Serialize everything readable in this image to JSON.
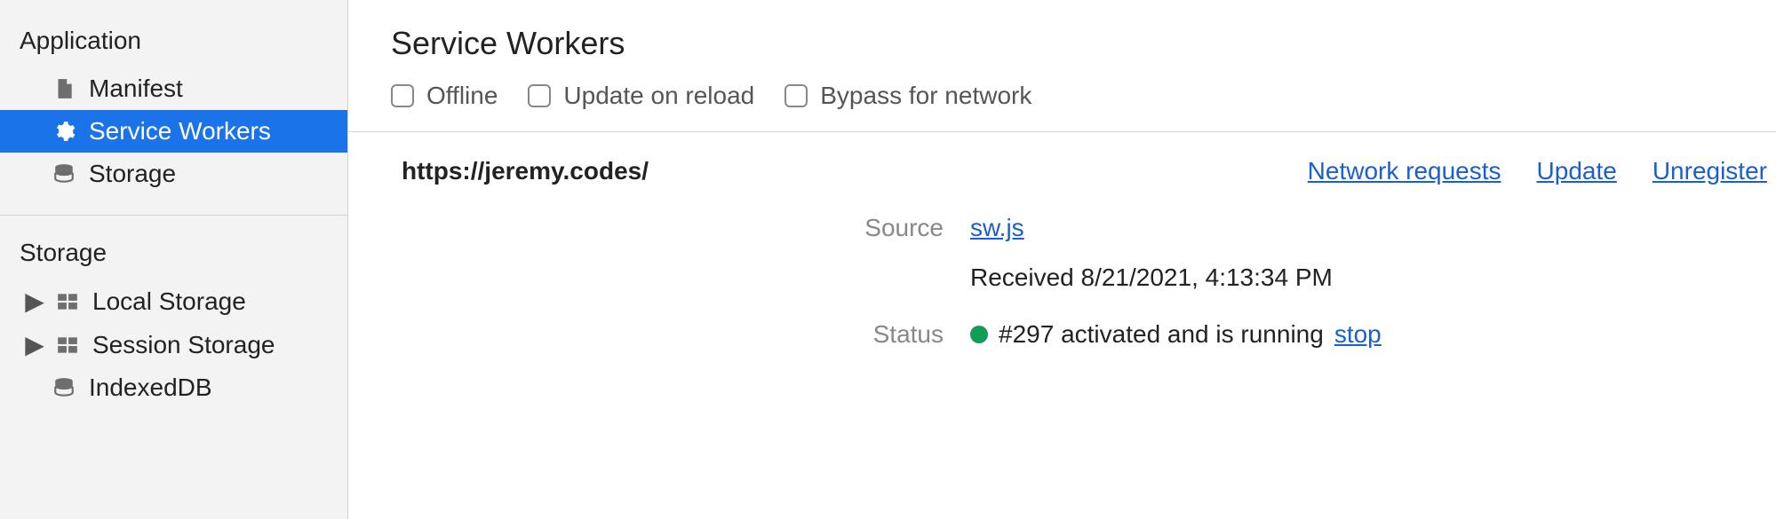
{
  "sidebar": {
    "sections": [
      {
        "title": "Application",
        "items": [
          {
            "label": "Manifest",
            "icon": "file",
            "selected": false,
            "expandable": false
          },
          {
            "label": "Service Workers",
            "icon": "gear",
            "selected": true,
            "expandable": false
          },
          {
            "label": "Storage",
            "icon": "db",
            "selected": false,
            "expandable": false
          }
        ]
      },
      {
        "title": "Storage",
        "items": [
          {
            "label": "Local Storage",
            "icon": "grid",
            "selected": false,
            "expandable": true
          },
          {
            "label": "Session Storage",
            "icon": "grid",
            "selected": false,
            "expandable": true
          },
          {
            "label": "IndexedDB",
            "icon": "db",
            "selected": false,
            "expandable": false
          }
        ]
      }
    ]
  },
  "main": {
    "heading": "Service Workers",
    "toolbar": {
      "offline": "Offline",
      "updateOnReload": "Update on reload",
      "bypass": "Bypass for network"
    },
    "origin": "https://jeremy.codes/",
    "actions": {
      "networkRequests": "Network requests",
      "update": "Update",
      "unregister": "Unregister"
    },
    "source": {
      "label": "Source",
      "file": "sw.js",
      "received": "Received 8/21/2021, 4:13:34 PM"
    },
    "status": {
      "label": "Status",
      "text": "#297 activated and is running",
      "stop": "stop"
    }
  }
}
